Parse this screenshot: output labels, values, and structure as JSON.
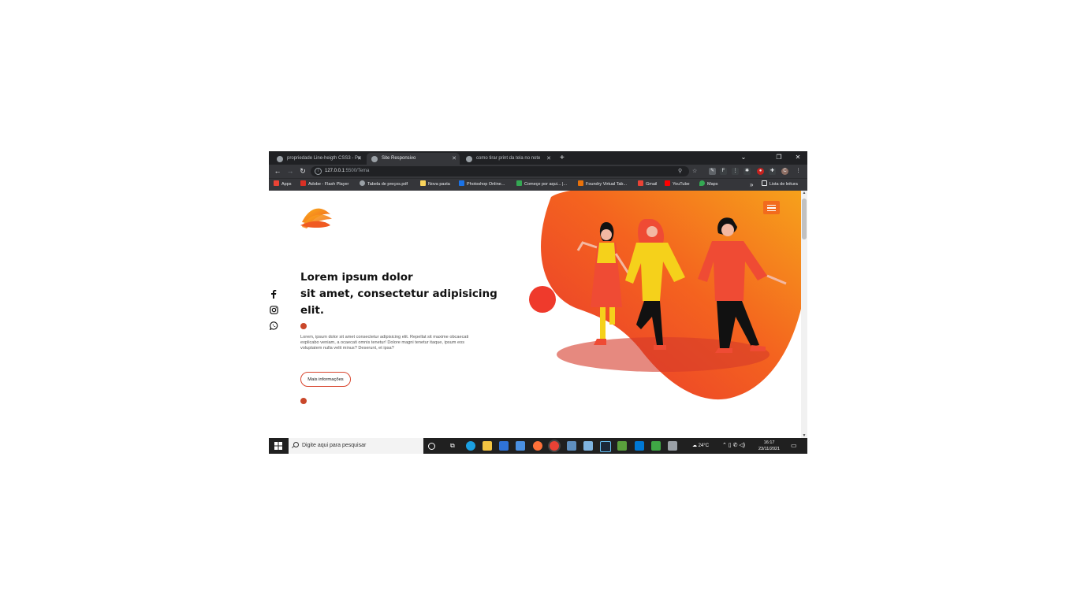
{
  "browser": {
    "tabs": [
      {
        "title": "propriedade Line-heigth CSS3 - Po",
        "active": false
      },
      {
        "title": "Site Responsivo",
        "active": true
      },
      {
        "title": "como tirar print da tela no note",
        "active": false
      }
    ],
    "new_tab": "+",
    "window_controls": [
      "⌄",
      "❐",
      "✕"
    ],
    "address": {
      "host": "127.0.0.1",
      "path": ":5500/Tema"
    },
    "bookmarks": [
      {
        "label": "Apps",
        "icon": "apps-grid-icon",
        "color": "#ea4335"
      },
      {
        "label": "Adobe - Flash Player",
        "icon": "adobe-icon",
        "color": "#d93025"
      },
      {
        "label": "Tabela de preços.pdf",
        "icon": "globe-icon",
        "color": "#9aa0a6"
      },
      {
        "label": "Nova pasta",
        "icon": "folder-icon",
        "color": "#f9d45c"
      },
      {
        "label": "Photoshop Online...",
        "icon": "photoshop-icon",
        "color": "#1a73e8"
      },
      {
        "label": "Começe por aqui... |...",
        "icon": "start-icon",
        "color": "#34a853"
      },
      {
        "label": "Foundry Virtual Tab...",
        "icon": "foundry-icon",
        "color": "#e8710a"
      },
      {
        "label": "Gmail",
        "icon": "gmail-icon",
        "color": "#ea4335"
      },
      {
        "label": "YouTube",
        "icon": "youtube-icon",
        "color": "#ff0000"
      },
      {
        "label": "Maps",
        "icon": "maps-icon",
        "color": "#34a853"
      }
    ],
    "more_bookmarks": "»",
    "reading_list": "Lista de leitura"
  },
  "page": {
    "headline": [
      "Lorem ipsum dolor",
      "sit amet, consectetur adipisicing",
      "elit."
    ],
    "body_text": "Lorem, ipsum dolor sit amet consectetur adipisicing elit. Repellat sit maxime obcaecati explicabo veniam, a ocaecati omnis tenetur! Dolore magni tenetur itaque, ipsum eos voluptatem nulla velit minus? Deserunt, et ipsa?",
    "cta_label": "Mais informações",
    "social": [
      "facebook-icon",
      "instagram-icon",
      "whatsapp-icon"
    ],
    "accent_color": "#f26b1d",
    "dot_color": "#c9472a"
  },
  "taskbar": {
    "search_placeholder": "Digite aqui para pesquisar",
    "weather": "24°C",
    "time": "16:17",
    "date": "23/11/2021"
  }
}
